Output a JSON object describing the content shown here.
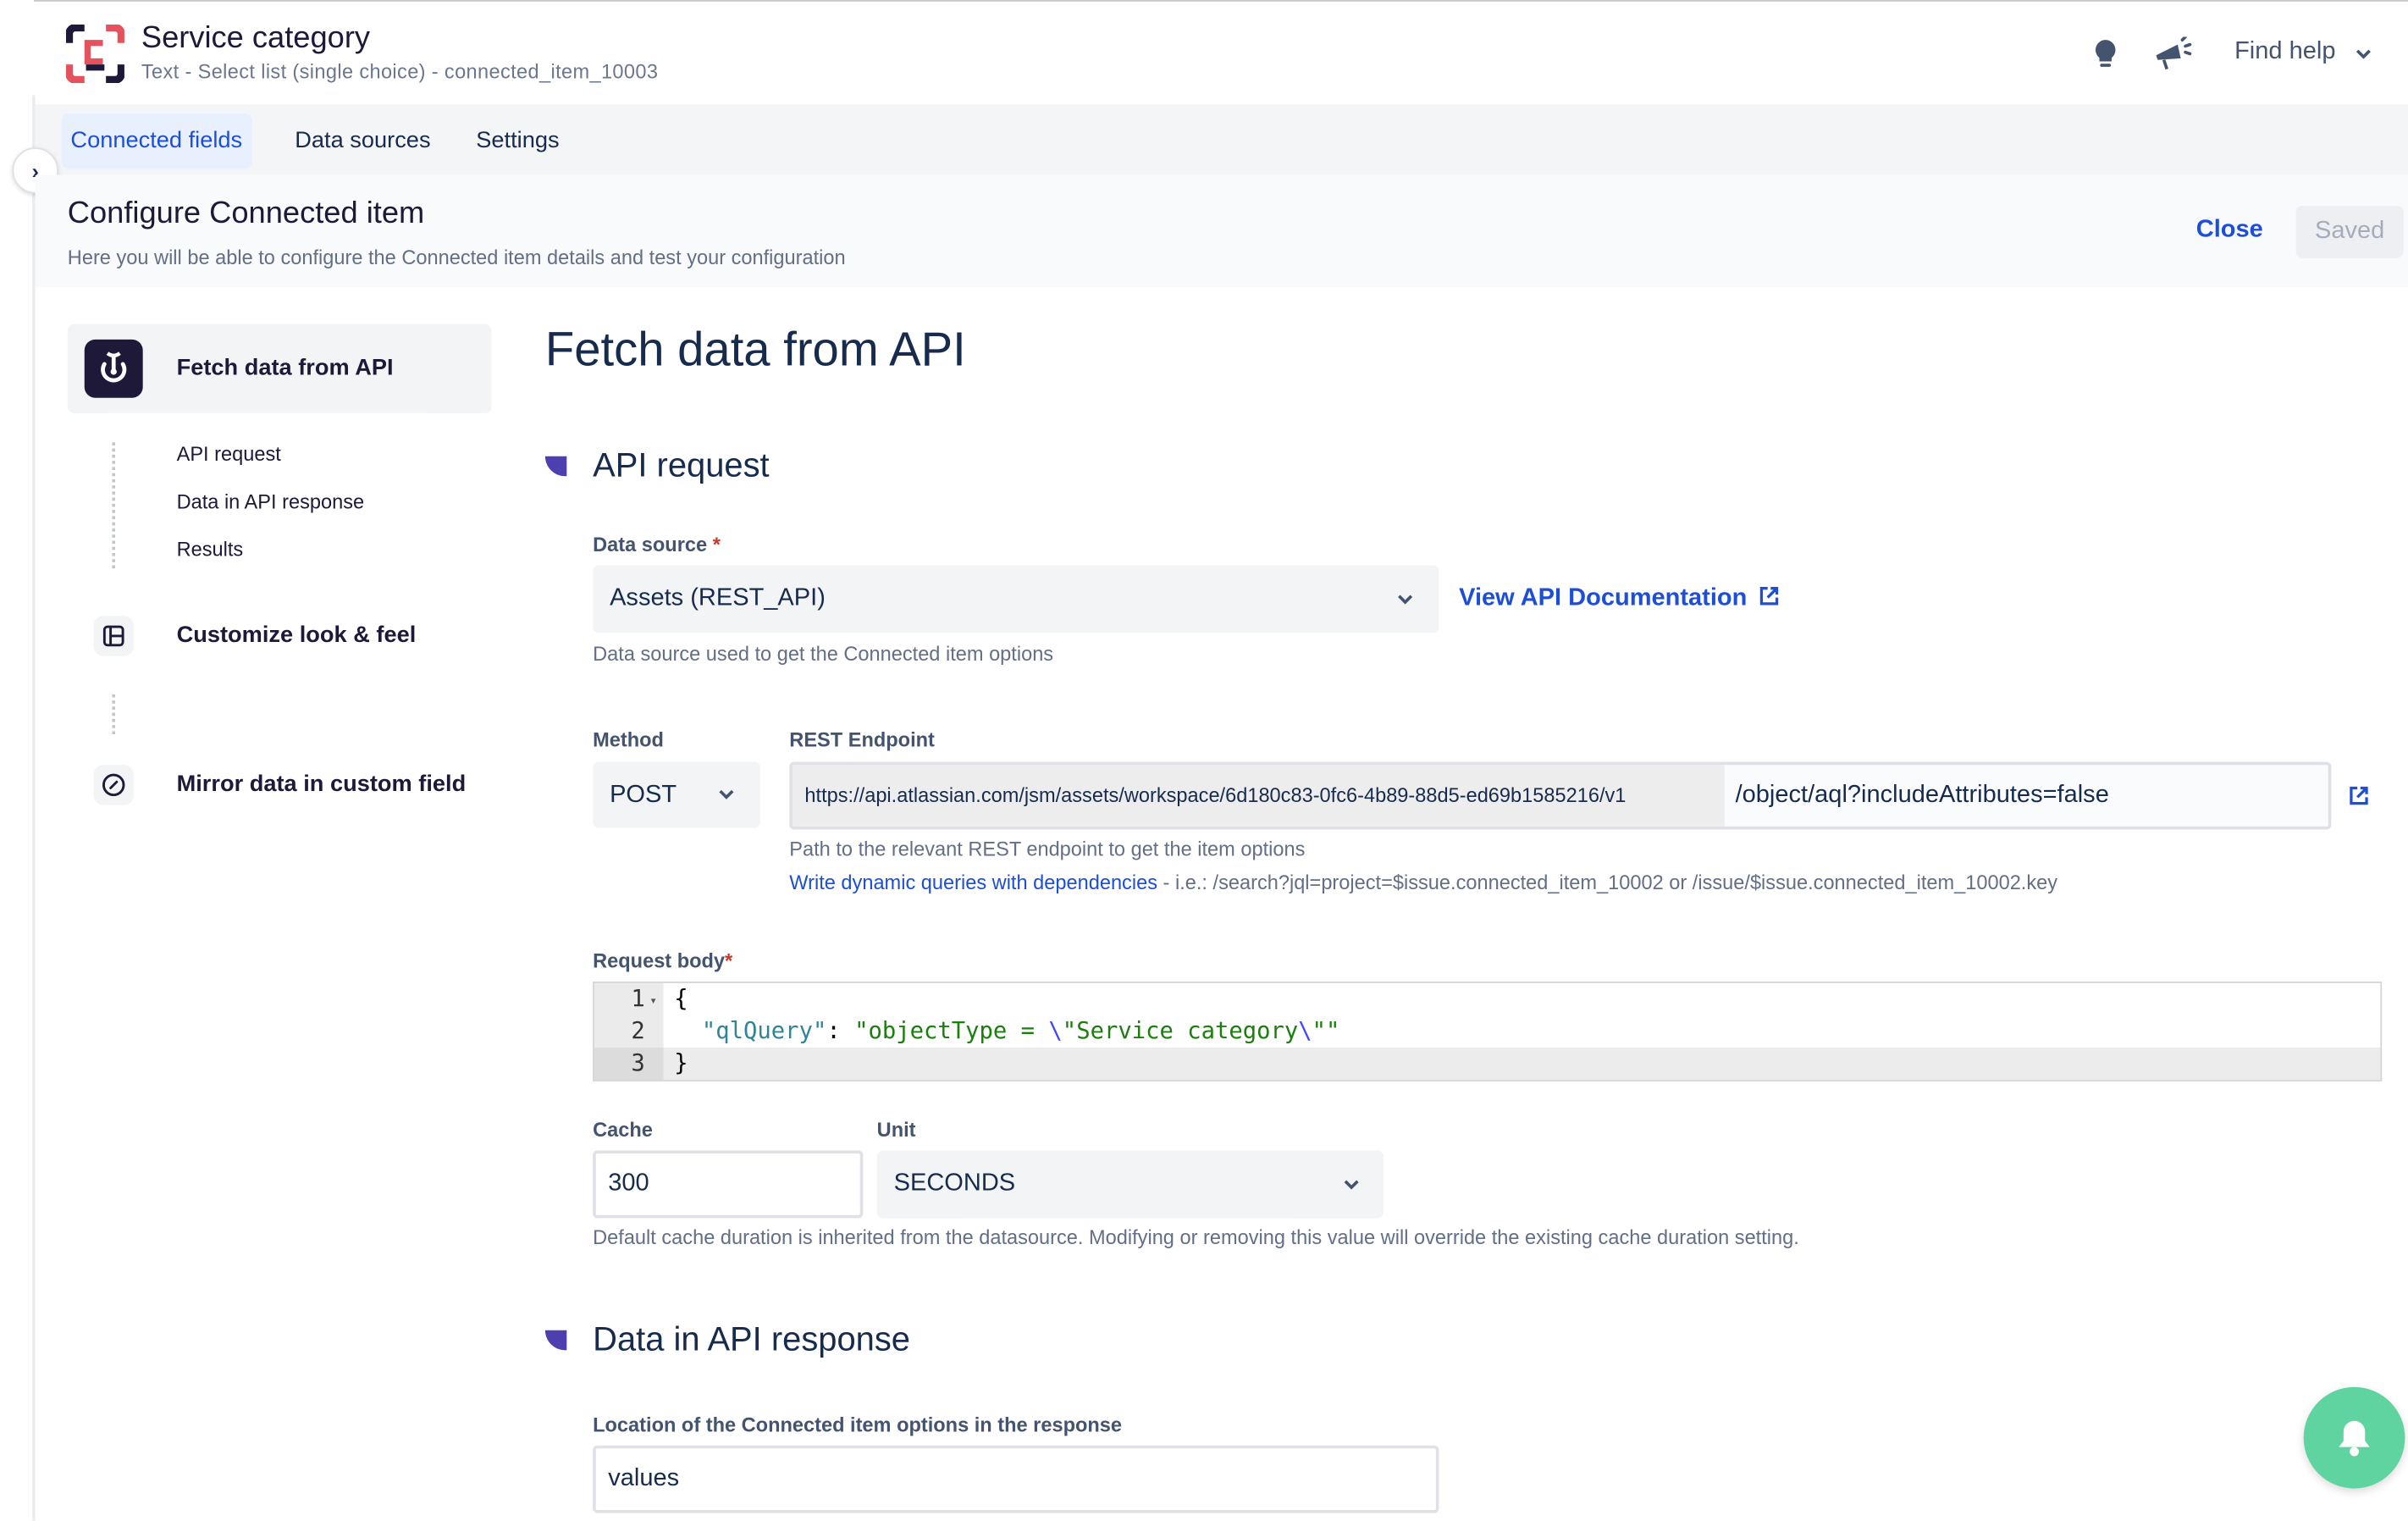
{
  "header": {
    "title": "Service category",
    "subtitle": "Text - Select list (single choice) - connected_item_10003",
    "find_help": "Find help",
    "icons": [
      "logo-icon",
      "lightbulb-icon",
      "megaphone-icon",
      "chevron-down-icon"
    ]
  },
  "tabs": [
    {
      "label": "Connected fields",
      "active": true
    },
    {
      "label": "Data sources",
      "active": false
    },
    {
      "label": "Settings",
      "active": false
    }
  ],
  "config": {
    "title": "Configure Connected item",
    "subtitle": "Here you will be able to configure the Connected item details and test your configuration",
    "close_label": "Close",
    "saved_label": "Saved"
  },
  "sidebar": {
    "steps": [
      {
        "label": "Fetch data from API",
        "selected": true,
        "sub": [
          "API request",
          "Data in API response",
          "Results"
        ]
      },
      {
        "label": "Customize look & feel"
      },
      {
        "label": "Mirror data in custom field"
      }
    ]
  },
  "main": {
    "title": "Fetch data from API",
    "api_request": {
      "heading": "API request",
      "data_source_label": "Data source",
      "required_mark": "*",
      "data_source_value": "Assets (REST_API)",
      "view_docs": "View API Documentation",
      "data_source_help": "Data source used to get the Connected item options",
      "method_label": "Method",
      "method_value": "POST",
      "endpoint_label": "REST Endpoint",
      "endpoint_prefix": "https://api.atlassian.com/jsm/assets/workspace/6d180c83-0fc6-4b89-88d5-ed69b1585216/v1",
      "endpoint_path": "/object/aql?includeAttributes=false",
      "endpoint_help": "Path to the relevant REST endpoint to get the item options",
      "dynamic_link": "Write dynamic queries with dependencies",
      "dynamic_example": " - i.e.: /search?jql=project=$issue.connected_item_10002 or /issue/$issue.connected_item_10002.key",
      "body_label": "Request body",
      "body_lines": [
        {
          "n": "1",
          "open": "{"
        },
        {
          "n": "2",
          "key": "\"qlQuery\"",
          "sep": ": ",
          "v1": "\"objectType = ",
          "e1": "\\",
          "v2": "\"Service category",
          "e2": "\\",
          "v3": "\"\""
        },
        {
          "n": "3",
          "close": "}"
        }
      ],
      "cache_label": "Cache",
      "cache_value": "300",
      "unit_label": "Unit",
      "unit_value": "SECONDS",
      "cache_help": "Default cache duration is inherited from the datasource. Modifying or removing this value will override the existing cache duration setting."
    },
    "response": {
      "heading": "Data in API response",
      "location_label": "Location of the Connected item options in the response",
      "location_value": "values"
    }
  },
  "colors": {
    "accent": "#1d4ed8",
    "brand_dark": "#1e1839",
    "marker": "#4c3fb0",
    "fab": "#5fd4a0",
    "logo_red": "#e5525b"
  }
}
